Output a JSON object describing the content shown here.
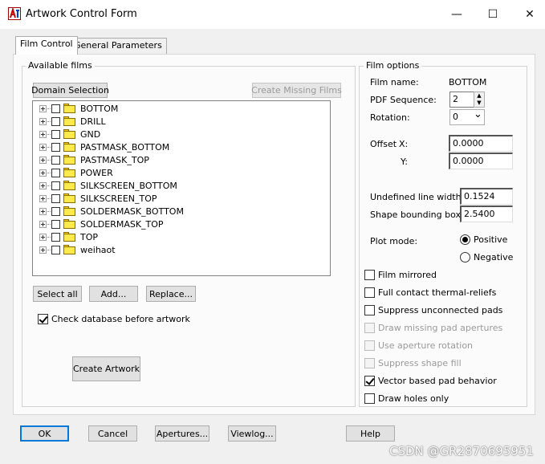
{
  "window": {
    "title": "Artwork Control Form",
    "minimize_glyph": "—",
    "maximize_glyph": "☐",
    "close_glyph": "✕"
  },
  "tabs": [
    {
      "label": "Film Control",
      "active": true
    },
    {
      "label": "General Parameters",
      "active": false
    }
  ],
  "available_films": {
    "legend": "Available films",
    "domain_button": "Domain Selection",
    "create_missing_button": "Create Missing Films",
    "films": [
      "BOTTOM",
      "DRILL",
      "GND",
      "PASTMASK_BOTTOM",
      "PASTMASK_TOP",
      "POWER",
      "SILKSCREEN_BOTTOM",
      "SILKSCREEN_TOP",
      "SOLDERMASK_BOTTOM",
      "SOLDERMASK_TOP",
      "TOP",
      "weihaot"
    ],
    "select_all_button": "Select all",
    "add_button": "Add...",
    "replace_button": "Replace...",
    "check_database_label": "Check database before artwork",
    "check_database_checked": true,
    "create_artwork_button": "Create Artwork"
  },
  "film_options": {
    "legend": "Film options",
    "film_name_label": "Film name:",
    "film_name_value": "BOTTOM",
    "pdf_sequence_label": "PDF Sequence:",
    "pdf_sequence_value": "2",
    "rotation_label": "Rotation:",
    "rotation_value": "0",
    "offset_label": "Offset",
    "offset_x_label": "X:",
    "offset_x_value": "0.0000",
    "offset_y_label": "Y:",
    "offset_y_value": "0.0000",
    "undefined_line_width_label": "Undefined line width:",
    "undefined_line_width_value": "0.1524",
    "shape_bounding_box_label": "Shape bounding box:",
    "shape_bounding_box_value": "2.5400",
    "plot_mode_label": "Plot mode:",
    "plot_mode_positive": "Positive",
    "plot_mode_negative": "Negative",
    "plot_mode_selected": "Positive",
    "checkboxes": [
      {
        "label": "Film mirrored",
        "checked": false,
        "enabled": true
      },
      {
        "label": "Full contact thermal-reliefs",
        "checked": false,
        "enabled": true
      },
      {
        "label": "Suppress unconnected pads",
        "checked": false,
        "enabled": true
      },
      {
        "label": "Draw missing pad apertures",
        "checked": false,
        "enabled": false
      },
      {
        "label": "Use aperture rotation",
        "checked": false,
        "enabled": false
      },
      {
        "label": "Suppress shape fill",
        "checked": false,
        "enabled": false
      },
      {
        "label": "Vector based pad behavior",
        "checked": true,
        "enabled": true
      },
      {
        "label": "Draw holes only",
        "checked": false,
        "enabled": true
      }
    ]
  },
  "footer": {
    "ok": "OK",
    "cancel": "Cancel",
    "apertures": "Apertures...",
    "viewlog": "Viewlog...",
    "help": "Help"
  },
  "watermark": "CSDN @GR2870695951",
  "icons": {
    "app": "artwork-app-icon",
    "folder": "folder-icon",
    "expander": "plus-box-icon",
    "spin_up": "▲",
    "spin_down": "▼",
    "dropdown": "⌄"
  }
}
